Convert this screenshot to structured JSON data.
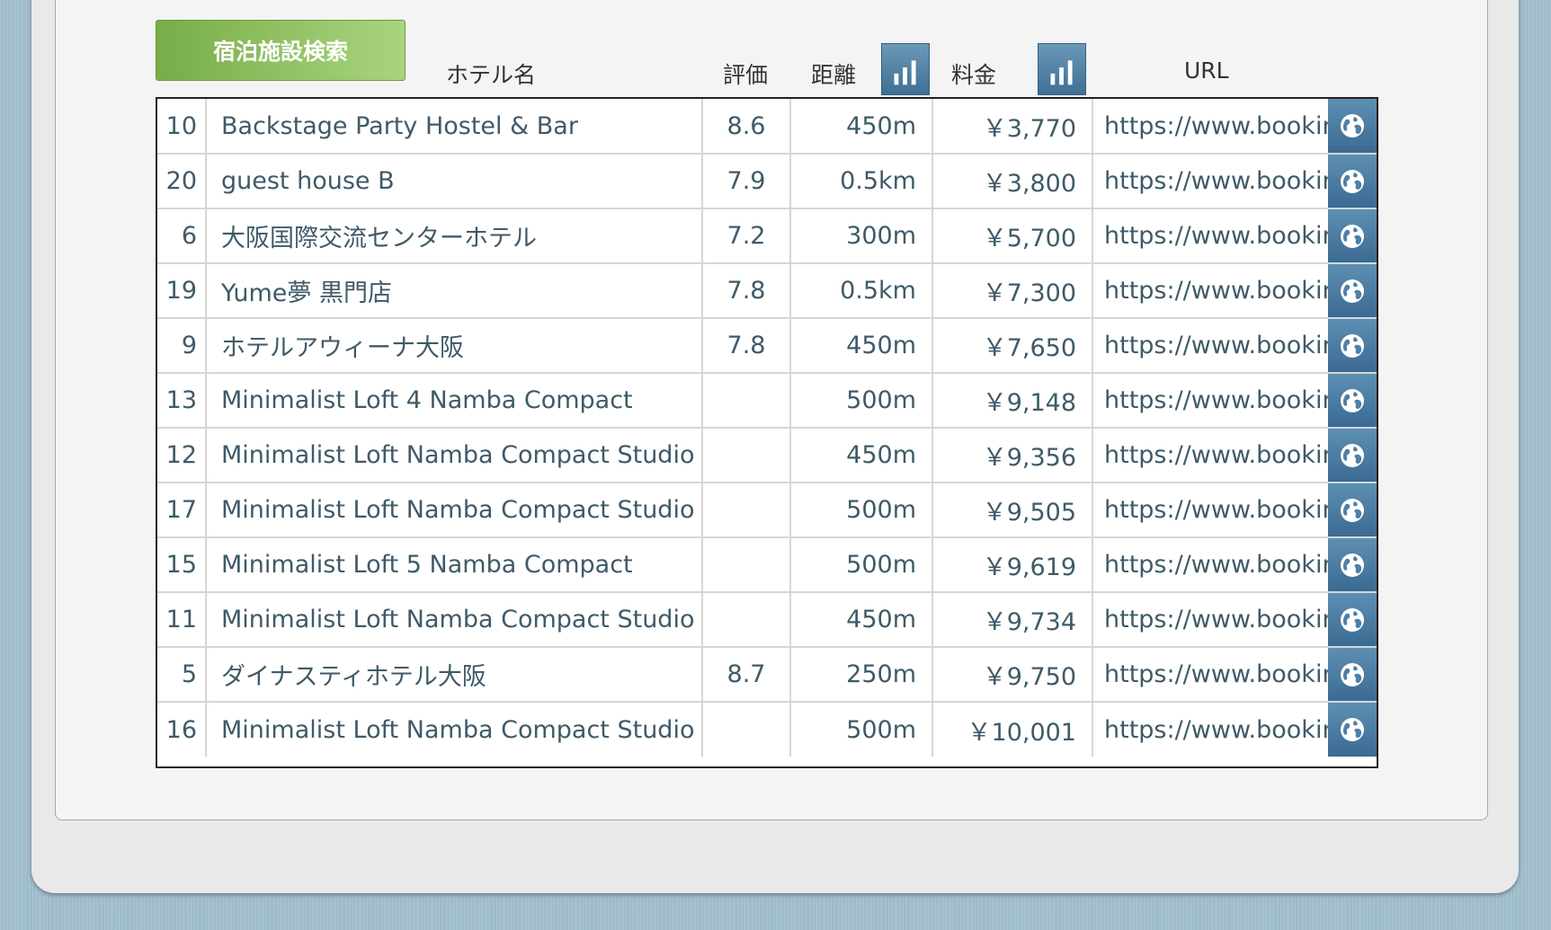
{
  "search_button_label": "宿泊施設検索",
  "columns": {
    "name": "ホテル名",
    "rating": "評価",
    "distance": "距離",
    "price": "料金",
    "url": "URL"
  },
  "icons": {
    "sort": "bar-chart-icon",
    "open_link": "globe-icon"
  },
  "rows": [
    {
      "no": "10",
      "name": "Backstage Party Hostel & Bar",
      "rating": "8.6",
      "distance": "450m",
      "price": "￥3,770",
      "url": "https://www.bookir"
    },
    {
      "no": "20",
      "name": "guest house B",
      "rating": "7.9",
      "distance": "0.5km",
      "price": "￥3,800",
      "url": "https://www.bookir"
    },
    {
      "no": "6",
      "name": "大阪国際交流センターホテル",
      "rating": "7.2",
      "distance": "300m",
      "price": "￥5,700",
      "url": "https://www.bookir"
    },
    {
      "no": "19",
      "name": "Yume夢 黒門店",
      "rating": "7.8",
      "distance": "0.5km",
      "price": "￥7,300",
      "url": "https://www.bookir"
    },
    {
      "no": "9",
      "name": "ホテルアウィーナ大阪",
      "rating": "7.8",
      "distance": "450m",
      "price": "￥7,650",
      "url": "https://www.bookir"
    },
    {
      "no": "13",
      "name": "Minimalist Loft 4 Namba Compact",
      "rating": "",
      "distance": "500m",
      "price": "￥9,148",
      "url": "https://www.bookir"
    },
    {
      "no": "12",
      "name": "Minimalist Loft Namba Compact Studio",
      "rating": "",
      "distance": "450m",
      "price": "￥9,356",
      "url": "https://www.bookir"
    },
    {
      "no": "17",
      "name": "Minimalist Loft Namba Compact Studio",
      "rating": "",
      "distance": "500m",
      "price": "￥9,505",
      "url": "https://www.bookir"
    },
    {
      "no": "15",
      "name": "Minimalist Loft 5 Namba Compact",
      "rating": "",
      "distance": "500m",
      "price": "￥9,619",
      "url": "https://www.bookir"
    },
    {
      "no": "11",
      "name": "Minimalist Loft Namba Compact Studio",
      "rating": "",
      "distance": "450m",
      "price": "￥9,734",
      "url": "https://www.bookir"
    },
    {
      "no": "5",
      "name": "ダイナスティホテル大阪",
      "rating": "8.7",
      "distance": "250m",
      "price": "￥9,750",
      "url": "https://www.bookir"
    },
    {
      "no": "16",
      "name": "Minimalist Loft Namba Compact Studio",
      "rating": "",
      "distance": "500m",
      "price": "￥10,001",
      "url": "https://www.bookir"
    }
  ]
}
